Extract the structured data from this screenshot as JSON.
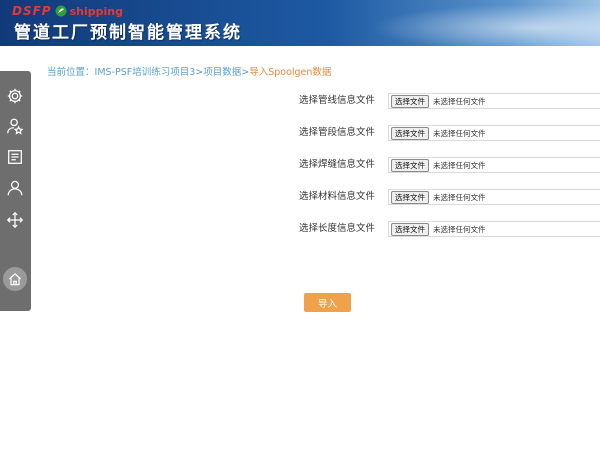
{
  "header": {
    "logo_text": "DSFP",
    "logo_sub": "shipping",
    "title": "管道工厂预制智能管理系统"
  },
  "sidebar": {
    "items": [
      {
        "icon": "gear-icon"
      },
      {
        "icon": "user-star-icon"
      },
      {
        "icon": "document-icon"
      },
      {
        "icon": "user-icon"
      },
      {
        "icon": "move-arrows-icon"
      },
      {
        "icon": "home-icon"
      }
    ]
  },
  "breadcrumb": {
    "prefix": "当前位置：",
    "items": [
      "IMS-PSF培训练习项目3",
      "项目数据"
    ],
    "separator": ">",
    "current": "导入Spoolgen数据"
  },
  "file_rows": [
    {
      "label": "选择管线信息文件",
      "button": "选择文件",
      "status": "未选择任何文件"
    },
    {
      "label": "选择管段信息文件",
      "button": "选择文件",
      "status": "未选择任何文件"
    },
    {
      "label": "选择焊缝信息文件",
      "button": "选择文件",
      "status": "未选择任何文件"
    },
    {
      "label": "选择材料信息文件",
      "button": "选择文件",
      "status": "未选择任何文件"
    },
    {
      "label": "选择长度信息文件",
      "button": "选择文件",
      "status": "未选择任何文件"
    }
  ],
  "actions": {
    "import_label": "导入"
  },
  "colors": {
    "header_dark": "#123a7a",
    "sidebar": "#6e6e6e",
    "breadcrumb_link": "#5aa0c8",
    "breadcrumb_current": "#e8873a",
    "import_button": "#f0a24a",
    "logo": "#e53935"
  }
}
